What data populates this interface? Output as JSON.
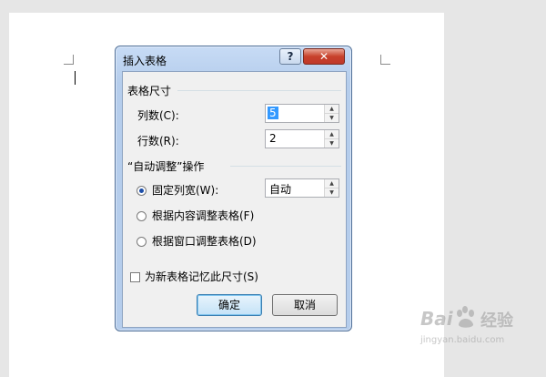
{
  "dialog": {
    "title": "插入表格",
    "help_label": "?",
    "close_label": "✕",
    "size_group": {
      "title": "表格尺寸",
      "columns_label": "列数(C):",
      "columns_value": "5",
      "rows_label": "行数(R):",
      "rows_value": "2"
    },
    "autofit_group": {
      "title": "“自动调整”操作",
      "fixed_label": "固定列宽(W):",
      "fixed_value": "自动",
      "content_label": "根据内容调整表格(F)",
      "window_label": "根据窗口调整表格(D)",
      "selected": "fixed"
    },
    "remember_label": "为新表格记忆此尺寸(S)",
    "remember_checked": false,
    "ok_label": "确定",
    "cancel_label": "取消"
  },
  "watermark": {
    "brand": "Bai",
    "suffix": "经验",
    "url": "jingyan.baidu.com"
  },
  "colors": {
    "frame": "#b5cdec",
    "close": "#c0392b",
    "selection": "#3399ff"
  }
}
